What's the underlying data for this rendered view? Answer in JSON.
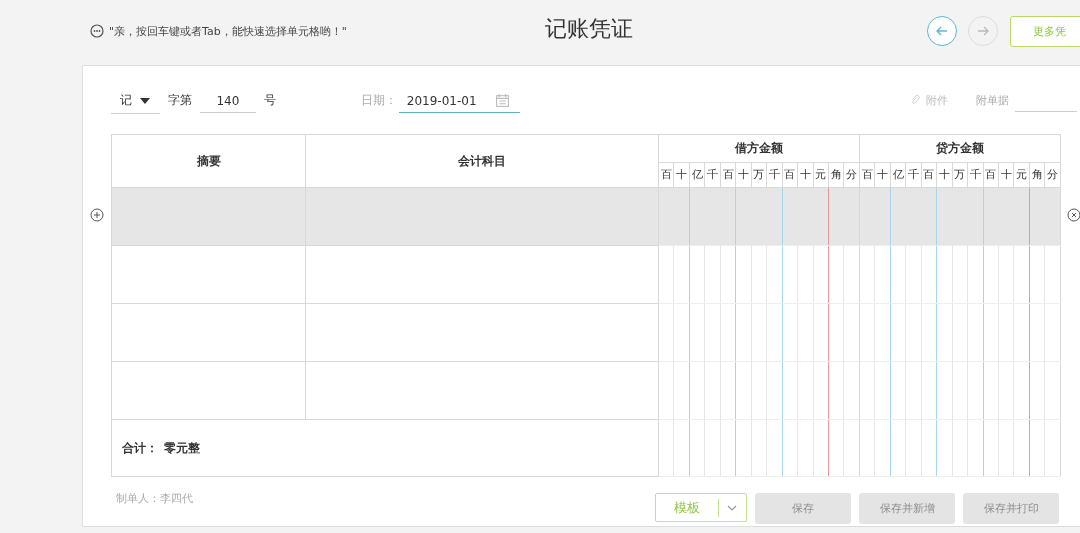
{
  "hint": "\"亲，按回车键或者Tab，能快速选择单元格哟！\"",
  "title": "记账凭证",
  "nav": [
    {
      "disabled": false
    },
    {
      "disabled": true
    }
  ],
  "more_button": "更多凭",
  "form": {
    "voucher_type": "记",
    "word_label": "字第",
    "number": "140",
    "number_suffix": "号",
    "date_label": "日期：",
    "date": "2019-01-01",
    "attachment_link": "附件",
    "attached_docs_label": "附单据"
  },
  "table": {
    "columns": [
      "摘要",
      "会计科目"
    ],
    "debit": {
      "title": "借方金额",
      "units": [
        "百",
        "十",
        "亿",
        "千",
        "百",
        "十",
        "万",
        "千",
        "百",
        "十",
        "元",
        "角",
        "分"
      ]
    },
    "credit": {
      "title": "贷方金额",
      "units": [
        "百",
        "十",
        "亿",
        "千",
        "百",
        "十",
        "万",
        "千",
        "百",
        "十",
        "元",
        "角",
        "分"
      ]
    },
    "rows": [
      {
        "selected": true
      },
      {
        "selected": false
      },
      {
        "selected": false
      },
      {
        "selected": false
      }
    ],
    "total_label": "合计：",
    "total_value": "零元整"
  },
  "preparer": "制单人：李四代",
  "buttons": [
    {
      "kind": "split",
      "label": "模板",
      "disabled": false
    },
    {
      "kind": "plain",
      "label": "保存",
      "disabled": true
    },
    {
      "kind": "plain",
      "label": "保存并新增",
      "disabled": true
    },
    {
      "kind": "plain",
      "label": "保存并打印",
      "disabled": true
    }
  ]
}
